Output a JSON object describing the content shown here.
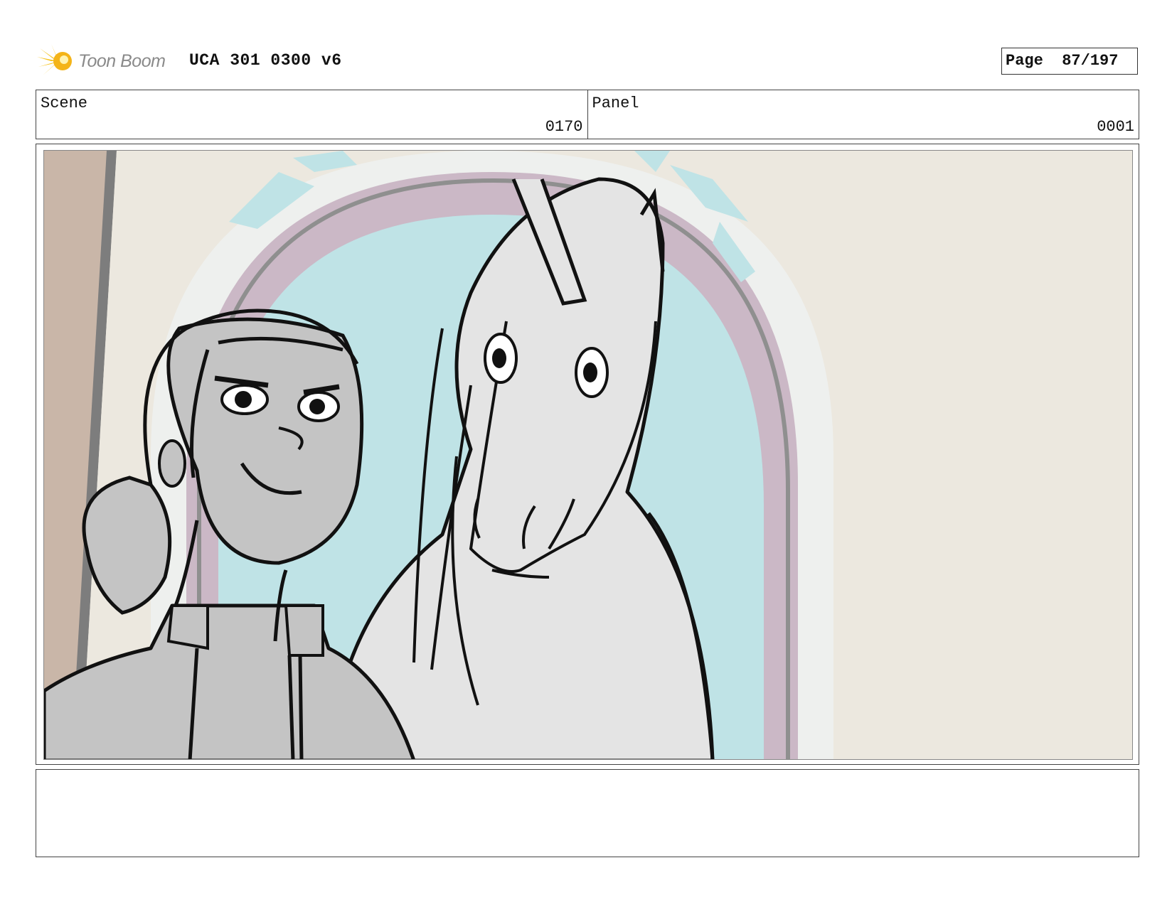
{
  "header": {
    "logo_text": "Toon Boom",
    "doc_title": "UCA 301 0300 v6",
    "page_label": "Page",
    "page_number": "87/197",
    "page_display": "Page  87/197"
  },
  "info": {
    "scene_label": "Scene",
    "scene_value": "0170",
    "panel_label": "Panel",
    "panel_value": "0001"
  },
  "artwork": {
    "description_icon": "storyboard-sketch",
    "colors": {
      "wall": "#ece8df",
      "arch_frame": "#eef0ee",
      "arch_band": "#cbb8c6",
      "sky": "#bfe3e6",
      "girl": "#c4c4c4",
      "horse": "#e4e4e4",
      "door": "#c8b4a6"
    }
  },
  "notes": {
    "text": ""
  }
}
